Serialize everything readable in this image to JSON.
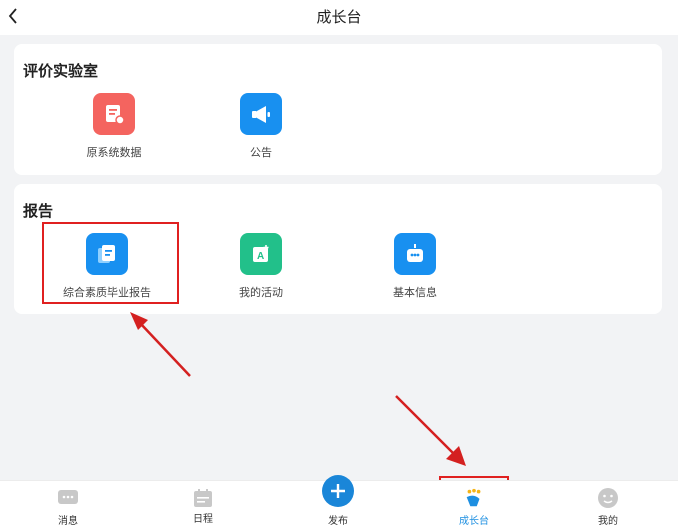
{
  "header": {
    "title": "成长台",
    "back_icon": "chevron-left-icon"
  },
  "lab_section": {
    "title": "评价实验室",
    "items": [
      {
        "label": "原系统数据",
        "icon": "document-badge-icon",
        "color": "#f4645f"
      },
      {
        "label": "公告",
        "icon": "megaphone-icon",
        "color": "#1890f0"
      }
    ]
  },
  "report_section": {
    "title": "报告",
    "items": [
      {
        "label": "综合素质毕业报告",
        "icon": "report-doc-icon",
        "color": "#1890f0"
      },
      {
        "label": "我的活动",
        "icon": "activity-icon",
        "color": "#22c08a"
      },
      {
        "label": "基本信息",
        "icon": "robot-info-icon",
        "color": "#1890f0"
      }
    ]
  },
  "tabbar": {
    "tabs": [
      {
        "label": "消息",
        "icon": "chat-icon",
        "active": false
      },
      {
        "label": "日程",
        "icon": "calendar-icon",
        "active": false
      },
      {
        "label": "发布",
        "icon": "plus-icon",
        "active": false
      },
      {
        "label": "成长台",
        "icon": "growth-icon",
        "active": true
      },
      {
        "label": "我的",
        "icon": "face-icon",
        "active": false
      }
    ]
  },
  "colors": {
    "accent": "#1d8fe1",
    "annotation": "#e02020",
    "background": "#f2f3f5"
  }
}
